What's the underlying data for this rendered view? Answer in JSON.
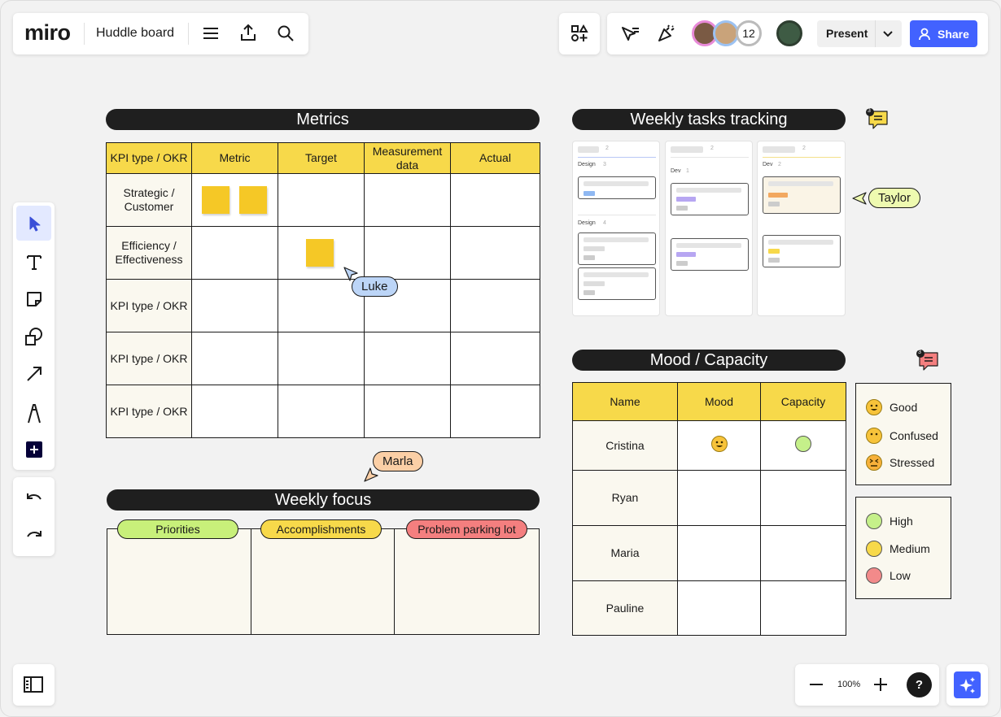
{
  "app": {
    "logo_text": "miro",
    "board_title": "Huddle board"
  },
  "topbar_right": {
    "collaborator_count": "12",
    "present_label": "Present",
    "share_label": "Share"
  },
  "zoom": {
    "level": "100%"
  },
  "metrics": {
    "title": "Metrics",
    "headers": [
      "KPI type / OKR",
      "Metric",
      "Target",
      "Measurement data",
      "Actual"
    ],
    "row_labels": [
      "Strategic / Customer",
      "Efficiency / Effectiveness",
      "KPI type / OKR",
      "KPI type / OKR",
      "KPI type / OKR"
    ]
  },
  "weekly_tasks": {
    "title": "Weekly tasks tracking",
    "columns": [
      {
        "count": "2",
        "groups": [
          {
            "name": "Design",
            "count": "3"
          },
          {
            "name": "Design",
            "count": "4"
          }
        ]
      },
      {
        "count": "2",
        "groups": [
          {
            "name": "Dev",
            "count": "1"
          }
        ]
      },
      {
        "count": "2",
        "groups": [
          {
            "name": "Dev",
            "count": "2"
          }
        ]
      }
    ]
  },
  "mood": {
    "title": "Mood / Capacity",
    "headers": [
      "Name",
      "Mood",
      "Capacity"
    ],
    "rows": [
      {
        "name": "Cristina",
        "mood": "good",
        "capacity": "high"
      },
      {
        "name": "Ryan",
        "mood": "",
        "capacity": ""
      },
      {
        "name": "Maria",
        "mood": "",
        "capacity": ""
      },
      {
        "name": "Pauline",
        "mood": "",
        "capacity": ""
      }
    ],
    "mood_legend": [
      "Good",
      "Confused",
      "Stressed"
    ],
    "capacity_legend": [
      {
        "label": "High",
        "color": "#c5f08a"
      },
      {
        "label": "Medium",
        "color": "#f7d94a"
      },
      {
        "label": "Low",
        "color": "#f28a8a"
      }
    ]
  },
  "weekly_focus": {
    "title": "Weekly focus",
    "columns": [
      {
        "label": "Priorities",
        "color": "#c8f07a"
      },
      {
        "label": "Accomplishments",
        "color": "#f7d94a"
      },
      {
        "label": "Problem parking lot",
        "color": "#f47f7f"
      }
    ]
  },
  "cursors": [
    {
      "name": "Luke",
      "color": "#bcd5f7"
    },
    {
      "name": "Taylor",
      "color": "#eefab0"
    },
    {
      "name": "Marla",
      "color": "#fbcfa6"
    }
  ],
  "comments": [
    {
      "count": "3"
    },
    {
      "count": "3"
    }
  ],
  "toolbar_icons": [
    "select-icon",
    "text-icon",
    "sticky-note-icon",
    "shapes-icon",
    "arrow-icon",
    "pen-icon",
    "add-icon",
    "undo-icon",
    "redo-icon"
  ],
  "colors": {
    "accent": "#4262ff",
    "banner": "#1f1f1f",
    "header_yellow": "#f7d94a"
  }
}
